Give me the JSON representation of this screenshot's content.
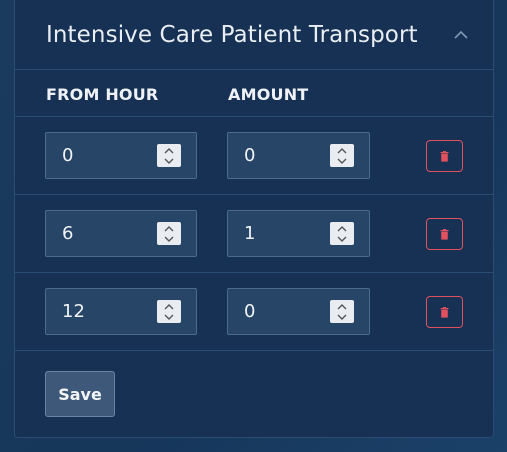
{
  "panel": {
    "title": "Intensive Care Patient Transport",
    "collapse_icon": "chevron-up-icon"
  },
  "columns": {
    "from_hour": "FROM HOUR",
    "amount": "AMOUNT"
  },
  "rows": [
    {
      "from_hour": "0",
      "amount": "0"
    },
    {
      "from_hour": "6",
      "amount": "1"
    },
    {
      "from_hour": "12",
      "amount": "0"
    }
  ],
  "actions": {
    "save_label": "Save",
    "delete_icon": "trash-icon"
  },
  "colors": {
    "background": "#16365a",
    "panel": "#163154",
    "input": "#274566",
    "delete_accent": "#e0515e",
    "save_button": "#3d5878"
  }
}
